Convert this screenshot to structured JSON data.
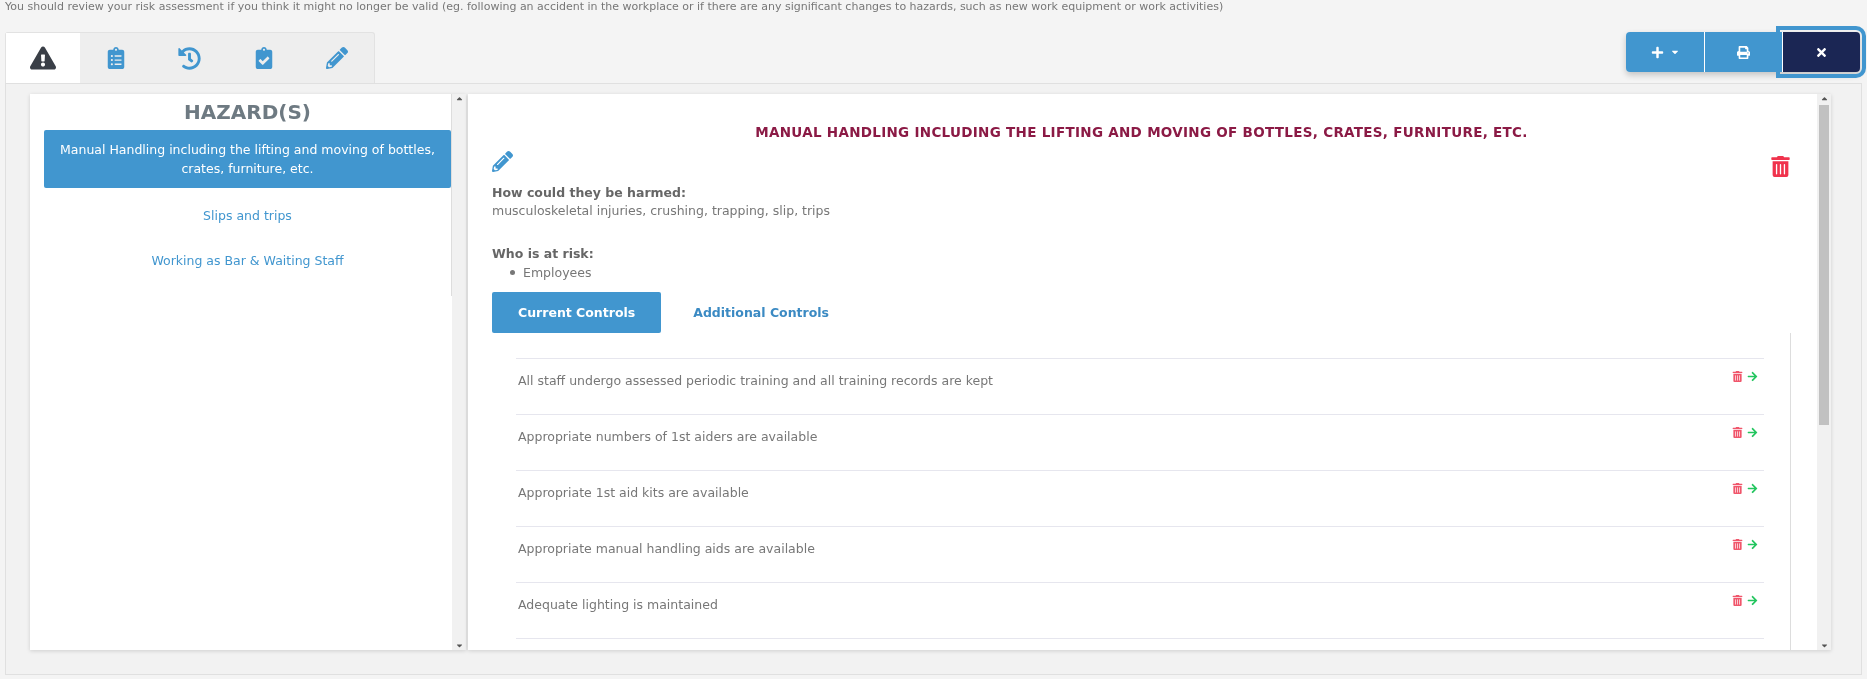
{
  "notice": "You should review your risk assessment if you think it might no longer be valid (eg. following an accident in the workplace or if there are any significant changes to hazards, such as new work equipment or work activities)",
  "tabs": [
    {
      "kind": "warning",
      "selected": true
    },
    {
      "kind": "list",
      "selected": false
    },
    {
      "kind": "history",
      "selected": false
    },
    {
      "kind": "check",
      "selected": false
    },
    {
      "kind": "edit",
      "selected": false
    }
  ],
  "toolbar": [
    {
      "kind": "add",
      "focused": false
    },
    {
      "kind": "print",
      "focused": false
    },
    {
      "kind": "close",
      "focused": true
    }
  ],
  "hazards": {
    "title": "HAZARD(S)",
    "items": [
      {
        "label": "Manual Handling including the lifting and moving of bottles, crates, furniture, etc.",
        "selected": true
      },
      {
        "label": "Slips and trips",
        "selected": false
      },
      {
        "label": "Working as Bar & Waiting Staff",
        "selected": false
      }
    ]
  },
  "detail": {
    "title": "MANUAL HANDLING INCLUDING THE LIFTING AND MOVING OF BOTTLES, CRATES, FURNITURE, ETC.",
    "harm_label": "How could they be harmed:",
    "harm_text": "musculoskeletal injuries, crushing, trapping, slip, trips",
    "risk_label": "Who is at risk:",
    "at_risk": [
      "Employees"
    ],
    "tabs": [
      {
        "label": "Current Controls",
        "selected": true
      },
      {
        "label": "Additional Controls",
        "selected": false
      }
    ],
    "controls": [
      "All staff undergo assessed periodic training and all training records are kept",
      "Appropriate numbers of 1st aiders are available",
      "Appropriate 1st aid kits are available",
      "Appropriate manual handling aids are available",
      "Adequate lighting is maintained"
    ]
  }
}
